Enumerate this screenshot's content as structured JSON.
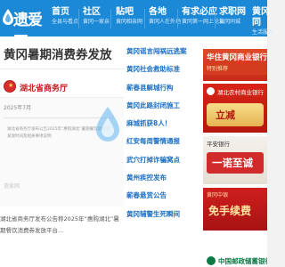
{
  "site": {
    "logo_text": "遗爱网"
  },
  "nav": [
    {
      "title": "首页",
      "sub": "全县与看点"
    },
    {
      "title": "社区",
      "sub": "黄冈一家亲"
    },
    {
      "title": "贴吧",
      "sub": "黄冈相亲网"
    },
    {
      "title": "各地",
      "sub": "黄冈人在外地"
    },
    {
      "title": "有求必应",
      "sub": "黄冈第一网上论坛"
    },
    {
      "title": "求职网",
      "sub": "黄冈同城"
    },
    {
      "title": "黄冈同",
      "sub": "生活服务"
    }
  ],
  "article": {
    "title": "黄冈暑期消费券发放",
    "screenshot": {
      "site_name": "湖北省商务厅",
      "date": "2025年7月",
      "lines": [
        "湖北省商务厅发布公告2025年“惠购湖北”暑期餐饮消费券",
        "发放时间及相关事项说明"
      ],
      "watermark": "遗爱网"
    },
    "body": "湖北省商务厅发布公告称2025年“惠购湖北”暑期餐饮消费券发放平台..."
  },
  "news_list": [
    "黄冈谣言闯祸远逃案",
    "黄冈社会救助标准",
    "蕲春县解城行构",
    "黄冈此路封闭施工",
    "麻城抓获8人！",
    "红安每周警情通报",
    "武穴打掉诈骗窝点",
    "黄州疾控发布",
    "蕲春悬赏公告",
    "黄冈辅警生死瞬间"
  ],
  "ads": {
    "ad1": {
      "title": "华住黄冈商业银行",
      "sub": "特别推荐"
    },
    "ad2": {
      "header": "湖北农村商业银行",
      "badge": "立减"
    },
    "ad3": {
      "header": "平安银行",
      "big": "一诺至诚"
    },
    "ad4": {
      "header": "黄冈中银",
      "big": "免手续费"
    },
    "ad5": {
      "text": "中国邮政储蓄银行"
    }
  },
  "colors": {
    "nav_bg": "#1c89d6",
    "link": "#1c6fc2",
    "ad_red": "#c62a18"
  }
}
